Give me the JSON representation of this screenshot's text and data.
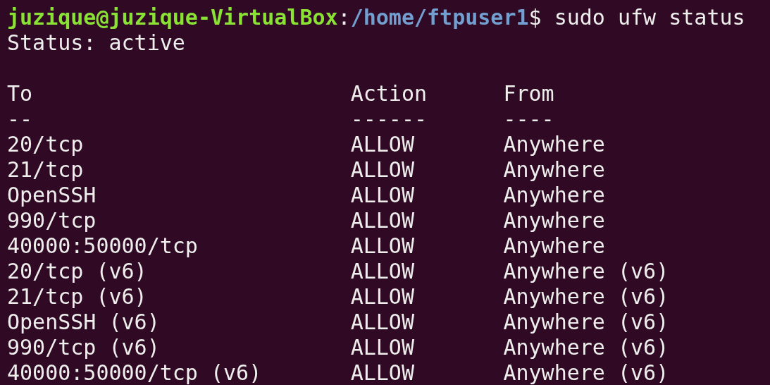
{
  "prompt": {
    "user_host": "juzique@juzique-VirtualBox",
    "separator": ":",
    "path": "/home/ftpuser1",
    "symbol": "$",
    "command": "sudo ufw status"
  },
  "status_line": "Status: active",
  "table": {
    "columns": [
      "To",
      "Action",
      "From"
    ],
    "dividers": [
      "--",
      "------",
      "----"
    ],
    "rows": [
      {
        "to": "20/tcp",
        "action": "ALLOW",
        "from": "Anywhere"
      },
      {
        "to": "21/tcp",
        "action": "ALLOW",
        "from": "Anywhere"
      },
      {
        "to": "OpenSSH",
        "action": "ALLOW",
        "from": "Anywhere"
      },
      {
        "to": "990/tcp",
        "action": "ALLOW",
        "from": "Anywhere"
      },
      {
        "to": "40000:50000/tcp",
        "action": "ALLOW",
        "from": "Anywhere"
      },
      {
        "to": "20/tcp (v6)",
        "action": "ALLOW",
        "from": "Anywhere (v6)"
      },
      {
        "to": "21/tcp (v6)",
        "action": "ALLOW",
        "from": "Anywhere (v6)"
      },
      {
        "to": "OpenSSH (v6)",
        "action": "ALLOW",
        "from": "Anywhere (v6)"
      },
      {
        "to": "990/tcp (v6)",
        "action": "ALLOW",
        "from": "Anywhere (v6)"
      },
      {
        "to": "40000:50000/tcp (v6)",
        "action": "ALLOW",
        "from": "Anywhere (v6)"
      }
    ]
  }
}
